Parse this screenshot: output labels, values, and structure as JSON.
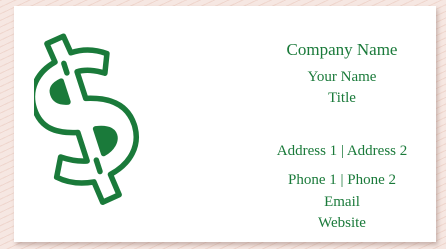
{
  "card": {
    "logo_icon": "dollar-sign-icon",
    "accent_color": "#1a7a3a",
    "company_name": "Company Name",
    "your_name": "Your Name",
    "title": "Title",
    "address": "Address 1 | Address 2",
    "phone": "Phone 1 | Phone 2",
    "email": "Email",
    "website": "Website"
  }
}
